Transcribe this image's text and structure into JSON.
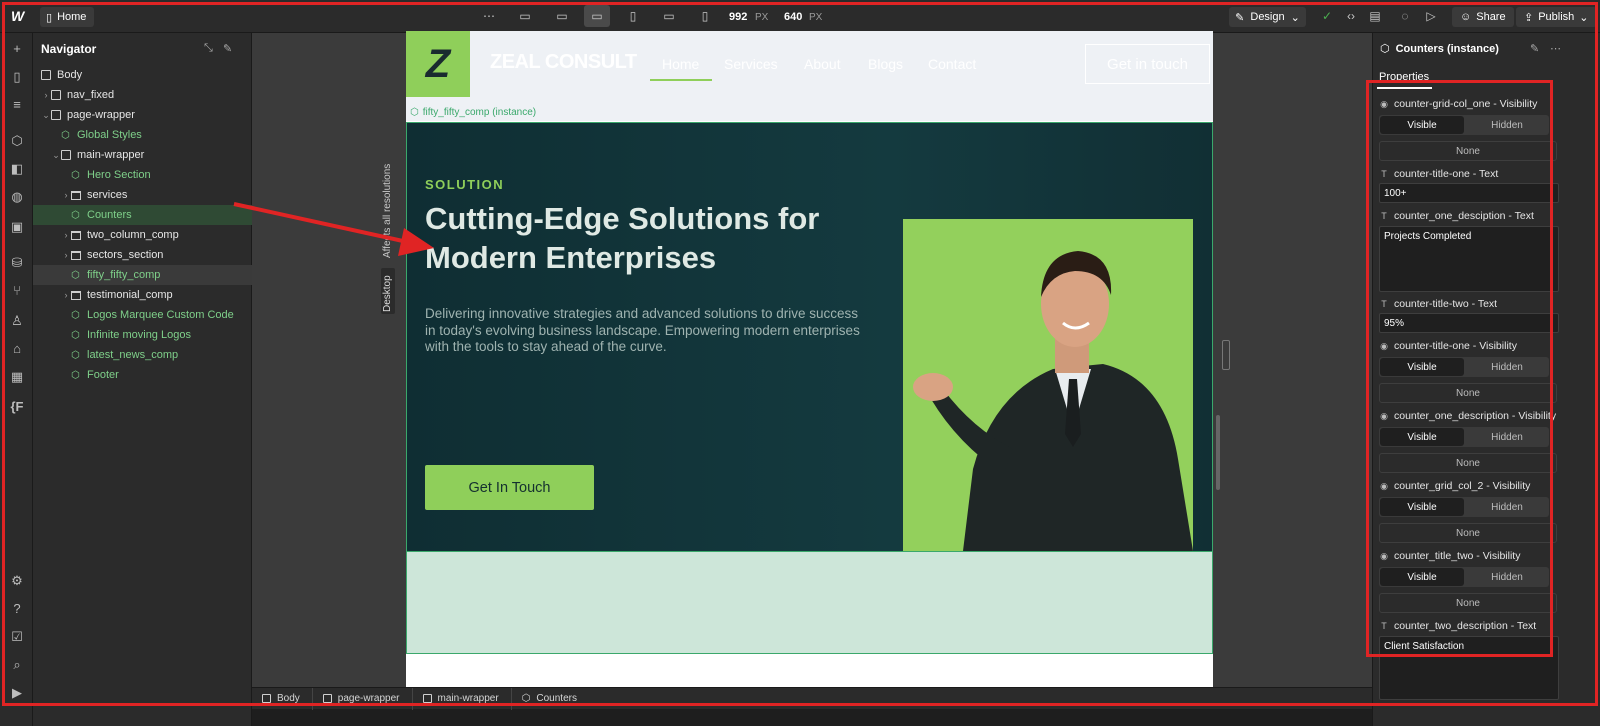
{
  "topbar": {
    "page_name": "Home",
    "width_value": "992",
    "width_unit": "PX",
    "height_value": "640",
    "height_unit": "PX",
    "design_label": "Design",
    "share_label": "Share",
    "publish_label": "Publish"
  },
  "navigator": {
    "title": "Navigator",
    "items": [
      {
        "label": "Body"
      },
      {
        "label": "nav_fixed"
      },
      {
        "label": "page-wrapper"
      },
      {
        "label": "Global Styles"
      },
      {
        "label": "main-wrapper"
      },
      {
        "label": "Hero Section"
      },
      {
        "label": "services"
      },
      {
        "label": "Counters"
      },
      {
        "label": "two_column_comp"
      },
      {
        "label": "sectors_section"
      },
      {
        "label": "fifty_fifty_comp"
      },
      {
        "label": "testimonial_comp"
      },
      {
        "label": "Logos Marquee Custom Code"
      },
      {
        "label": "Infinite moving Logos"
      },
      {
        "label": "latest_news_comp"
      },
      {
        "label": "Footer"
      }
    ]
  },
  "canvas": {
    "affects_label": "Affects all resolutions",
    "desktop_label": "Desktop",
    "component_tag": "fifty_fifty_comp (instance)"
  },
  "site": {
    "brand": "ZEAL CONSULT",
    "logo_letter": "Z",
    "menu": [
      "Home",
      "Services",
      "About",
      "Blogs",
      "Contact"
    ],
    "nav_button": "Get in touch",
    "eyebrow": "SOLUTION",
    "headline": "Cutting-Edge Solutions for Modern Enterprises",
    "body": "Delivering innovative strategies and advanced solutions to drive success in today's evolving business landscape. Empowering modern enterprises with the tools to stay ahead of the curve.",
    "cta": "Get In Touch"
  },
  "breadcrumbs": [
    "Body",
    "page-wrapper",
    "main-wrapper",
    "Counters"
  ],
  "panel": {
    "title": "Counters (instance)",
    "tab": "Properties",
    "visible_label": "Visible",
    "hidden_label": "Hidden",
    "none_label": "None",
    "props": {
      "p1": "counter-grid-col_one - Visibility",
      "p2": "counter-title-one - Text",
      "p2_value": "100+",
      "p3": "counter_one_desciption - Text",
      "p3_value": "Projects Completed",
      "p4": "counter-title-two - Text",
      "p4_value": "95%",
      "p5": "counter-title-one - Visibility",
      "p6": "counter_one_description - Visibility",
      "p7": "counter_grid_col_2 - Visibility",
      "p8": "counter_title_two - Visibility",
      "p9": "counter_two_description - Text",
      "p9_value": "Client Satisfaction"
    }
  },
  "colors": {
    "accent_green": "#8fcf5a",
    "annotation_red": "#e02424",
    "component_green": "#3aa86b"
  }
}
